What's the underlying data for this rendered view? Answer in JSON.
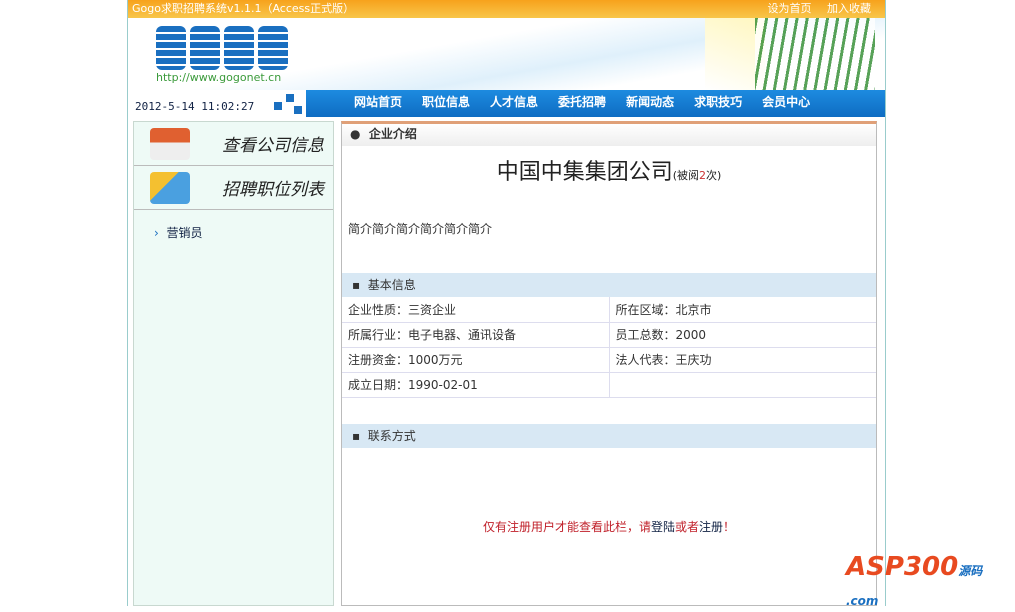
{
  "topbar": {
    "title": "Gogo求职招聘系统v1.1.1（Access正式版）",
    "set_home": "设为首页",
    "favorite": "加入收藏"
  },
  "header": {
    "logo_text": "GOGO",
    "url": "http://www.gogonet.cn",
    "datetime": "2012-5-14 11:02:27"
  },
  "nav": [
    "网站首页",
    "职位信息",
    "人才信息",
    "委托招聘",
    "新闻动态",
    "求职技巧",
    "会员中心"
  ],
  "sidebar": {
    "company_info": "查看公司信息",
    "job_list": "招聘职位列表",
    "jobs": [
      "营销员"
    ]
  },
  "main": {
    "section_title": "企业介绍",
    "company": "中国中集集团公司",
    "views_prefix": "(被阅",
    "views": "2",
    "views_suffix": "次)",
    "intro": "简介简介简介简介简介简介",
    "basic_title": "基本信息",
    "basic": [
      [
        "企业性质：三资企业",
        "所在区域：北京市"
      ],
      [
        "所属行业：电子电器、通讯设备",
        "员工总数：2000"
      ],
      [
        "注册资金：1000万元",
        "法人代表：王庆功"
      ],
      [
        "成立日期：1990-02-01",
        ""
      ]
    ],
    "contact_title": "联系方式",
    "notice": {
      "text": "仅有注册用户才能查看此栏，请",
      "login": "登陆",
      "or": "或者",
      "register": "注册",
      "excl": "！"
    }
  },
  "watermark": {
    "text": "ASP300",
    "sub": "源码 .com"
  }
}
